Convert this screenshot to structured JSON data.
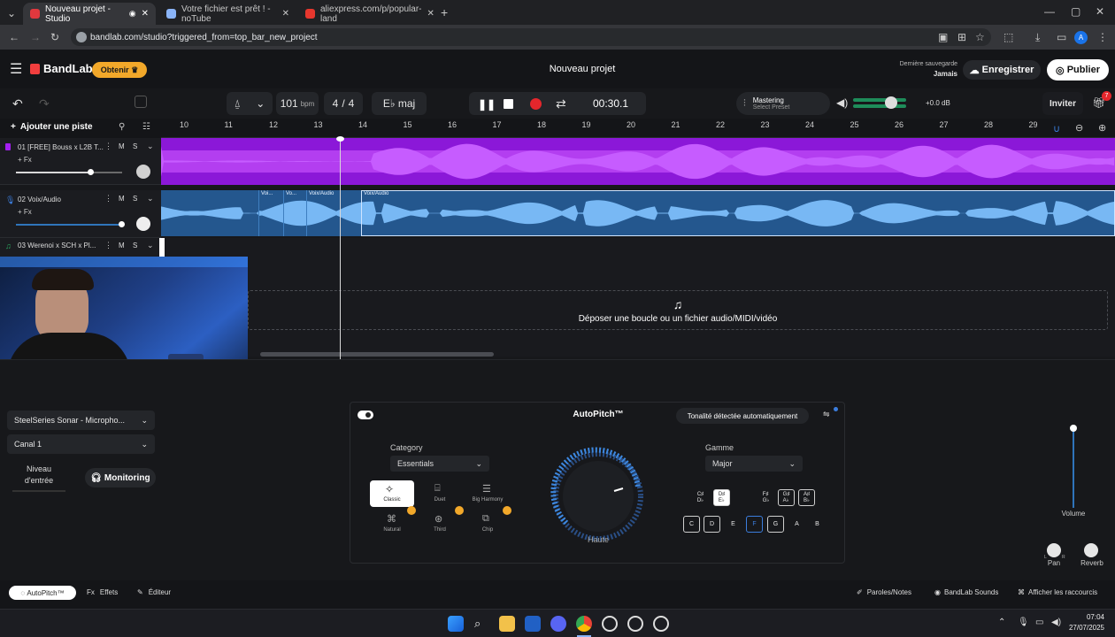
{
  "browser": {
    "tabs": [
      {
        "title": "Nouveau projet - Studio",
        "active": true,
        "color": "#e0383e"
      },
      {
        "title": "Votre fichier est prêt ! - noTube",
        "active": false,
        "color": "#8ab4f8"
      },
      {
        "title": "aliexpress.com/p/popular-land",
        "active": false,
        "color": "#e6372e"
      }
    ],
    "url": "bandlab.com/studio?triggered_from=top_bar_new_project",
    "profile_letter": "A"
  },
  "header": {
    "brand": "BandLab",
    "obtain_label": "Obtenir",
    "project_title": "Nouveau projet",
    "last_save_label": "Dernière sauvegarde",
    "last_save_value": "Jamais",
    "save_label": "Enregistrer",
    "publish_label": "Publier"
  },
  "transport": {
    "bpm_value": "101",
    "bpm_unit": "bpm",
    "time_sig_num": "4",
    "time_sig_sep": "/",
    "time_sig_den": "4",
    "key": "E♭ maj",
    "time": "00:30.1",
    "mastering_label": "Mastering",
    "mastering_preset": "Select Preset",
    "db_value": "+0.0 dB",
    "invite_label": "Inviter",
    "notification_count": "7"
  },
  "tracks_header": {
    "add_track_label": "Ajouter une piste"
  },
  "ruler": [
    "10",
    "11",
    "12",
    "13",
    "14",
    "15",
    "16",
    "17",
    "18",
    "19",
    "20",
    "21",
    "22",
    "23",
    "24",
    "25",
    "26",
    "27",
    "28",
    "29"
  ],
  "tracks": [
    {
      "name": "01  [FREE] Bouss x L2B T...",
      "fx": "+ Fx",
      "m": "M",
      "s": "S",
      "color": "#a41ff0"
    },
    {
      "name": "02  Voix/Audio",
      "fx": "+ Fx",
      "m": "M",
      "s": "S",
      "color": "#2f74ba"
    },
    {
      "name": "03  Werenoi x SCH x Pl...",
      "fx": "+ Fx",
      "m": "M",
      "s": "S",
      "color": "#2aa860"
    }
  ],
  "clips": [
    "Voi...",
    "Vo...",
    "Voix/Audio",
    "Voix/Audio"
  ],
  "drop_zone": "Déposer une boucle ou un fichier audio/MIDI/vidéo",
  "input": {
    "device": "SteelSeries Sonar - Micropho...",
    "channel": "Canal 1",
    "level_label_1": "Niveau",
    "level_label_2": "d'entrée",
    "monitoring_label": "Monitoring"
  },
  "autopitch": {
    "title": "AutoPitch™",
    "auto_detect_label": "Tonalité détectée automatiquement",
    "category_label": "Category",
    "category_value": "Essentials",
    "categories": [
      "Classic",
      "Duet",
      "Big Harmony",
      "Natural",
      "Third",
      "Chip"
    ],
    "knob_label": "Haute",
    "scale_label": "Gamme",
    "scale_value": "Major",
    "keys_top": [
      "C♯\nD♭",
      "D♯\nE♭",
      "F♯\nG♭",
      "G♯\nA♭",
      "A♯\nB♭"
    ],
    "keys_bottom": [
      "C",
      "D",
      "E",
      "F",
      "G",
      "A",
      "B"
    ],
    "volume_label": "Volume",
    "pan_label": "Pan",
    "reverb_label": "Reverb",
    "pan_l": "L",
    "pan_r": "R"
  },
  "bottombar": {
    "autopitch_tab": "AutoPitch™",
    "effects_tab": "Effets",
    "editor_tab": "Éditeur",
    "lyrics_label": "Paroles/Notes",
    "sounds_label": "BandLab Sounds",
    "shortcuts_label": "Afficher les raccourcis"
  },
  "taskbar": {
    "time": "07:04",
    "date": "27/07/2025"
  }
}
